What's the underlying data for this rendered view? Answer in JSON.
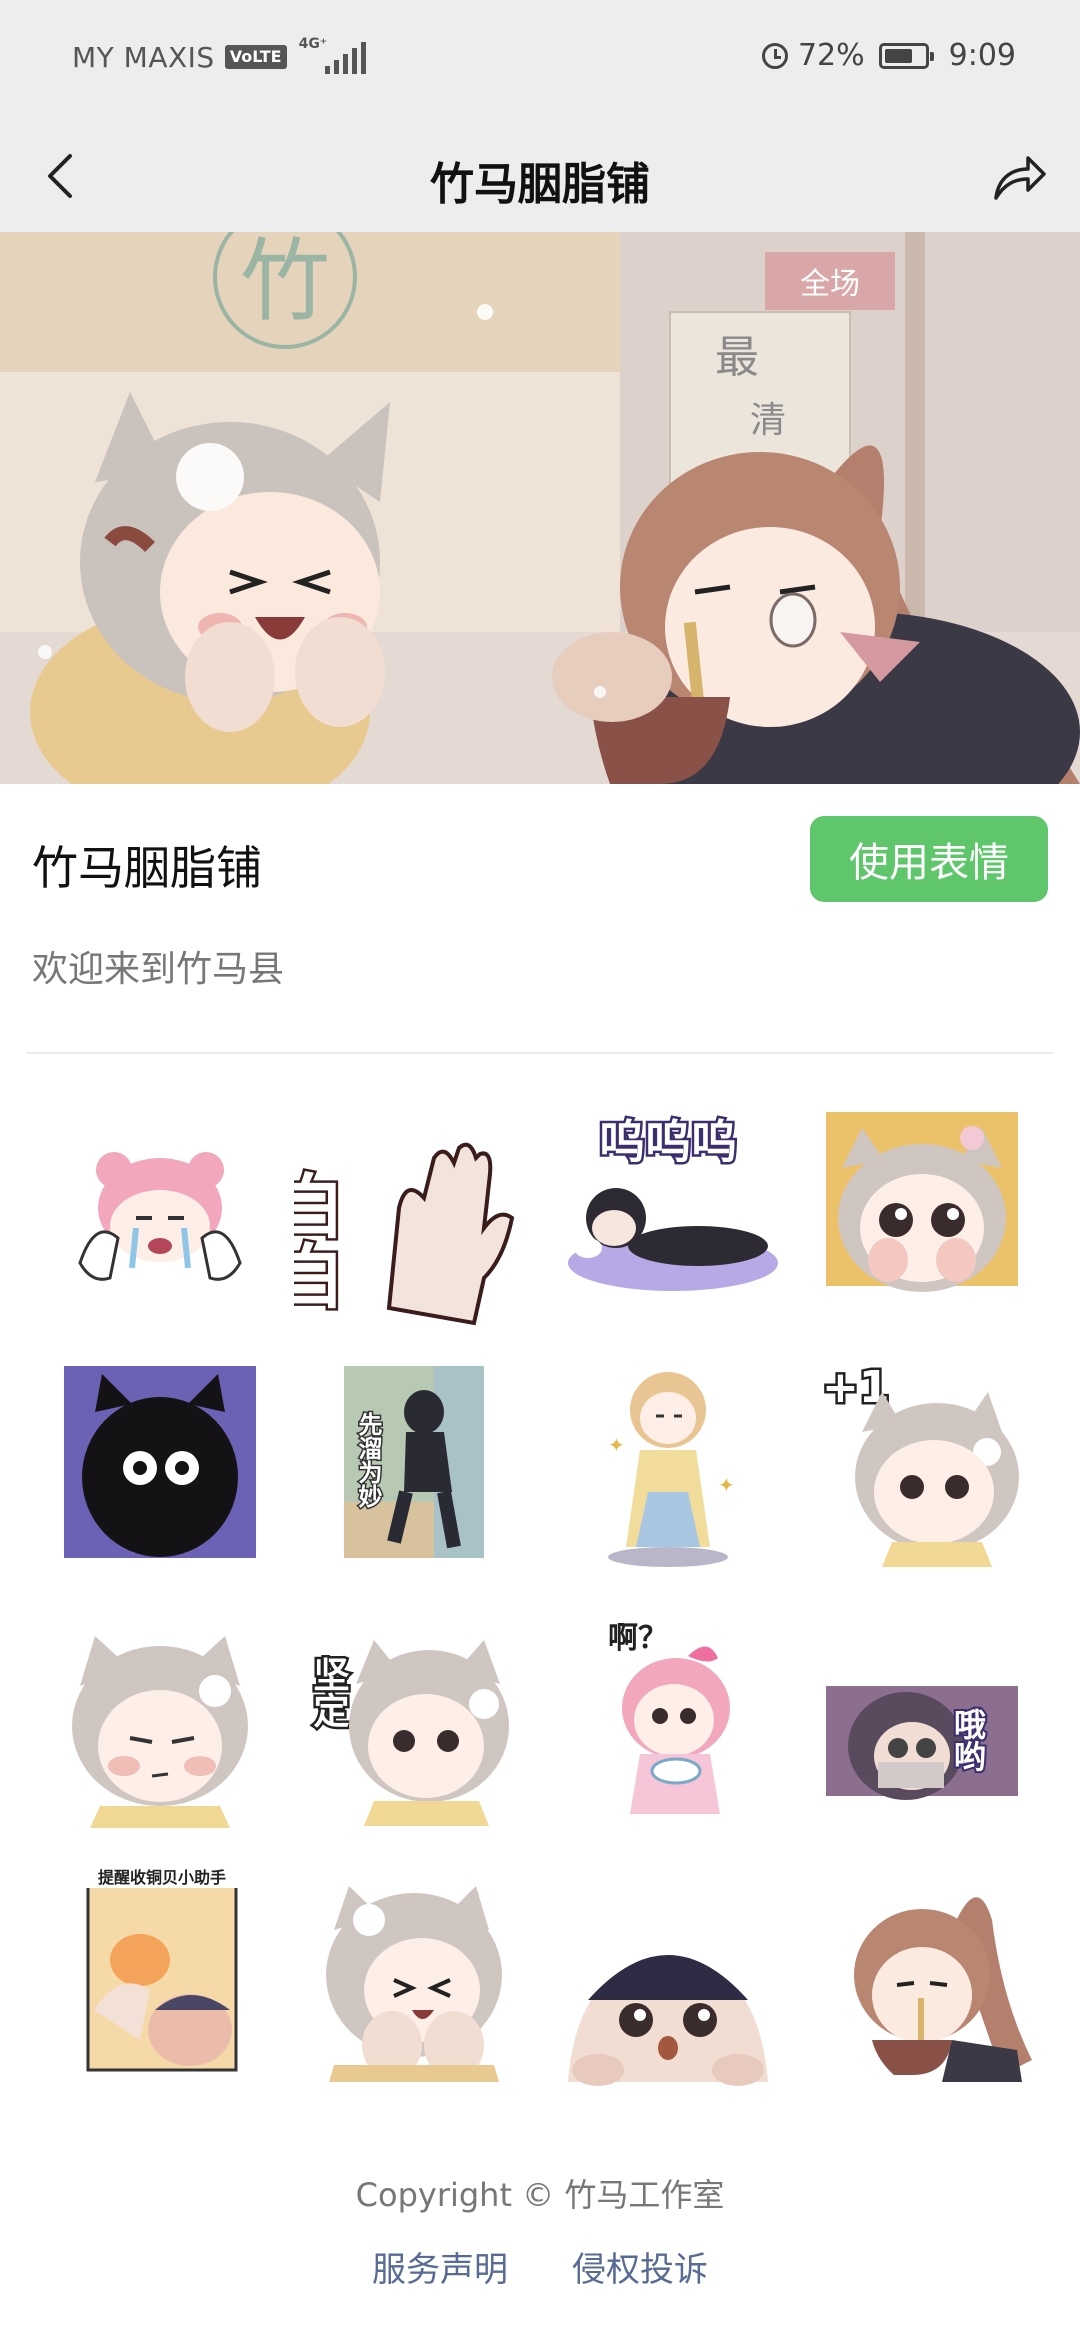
{
  "status_bar": {
    "carrier": "MY MAXIS",
    "volte": "VoLTE",
    "network": "4G⁺",
    "battery_text": "72%",
    "battery_level": 0.72,
    "time": "9:09",
    "icons": [
      "signal-icon",
      "alarm-icon",
      "battery-icon"
    ]
  },
  "nav": {
    "title": "竹马胭脂铺",
    "icons": [
      "back-icon",
      "share-icon"
    ]
  },
  "banner": {
    "signs": [
      "竹",
      "全场",
      "最",
      "清"
    ]
  },
  "pack": {
    "name": "竹马胭脂铺",
    "button": "使用表情",
    "description": "欢迎来到竹马县"
  },
  "stickers": [
    {
      "caption": ""
    },
    {
      "caption": "白白"
    },
    {
      "caption": "呜呜呜"
    },
    {
      "caption": ""
    },
    {
      "caption": ""
    },
    {
      "caption": "先溜为妙"
    },
    {
      "caption": ""
    },
    {
      "caption": "+1"
    },
    {
      "caption": ""
    },
    {
      "caption": "坚定"
    },
    {
      "caption": "啊？"
    },
    {
      "caption": "哦哟"
    },
    {
      "caption": "提醒收铜贝小助手"
    },
    {
      "caption": ""
    },
    {
      "caption": ""
    },
    {
      "caption": ""
    }
  ],
  "footer": {
    "copyright": "Copyright © 竹马工作室",
    "links": [
      "服务声明",
      "侵权投诉"
    ]
  },
  "colors": {
    "accent_green": "#5fc66c",
    "link_blue": "#576b95",
    "bar_gray": "#ededed"
  }
}
